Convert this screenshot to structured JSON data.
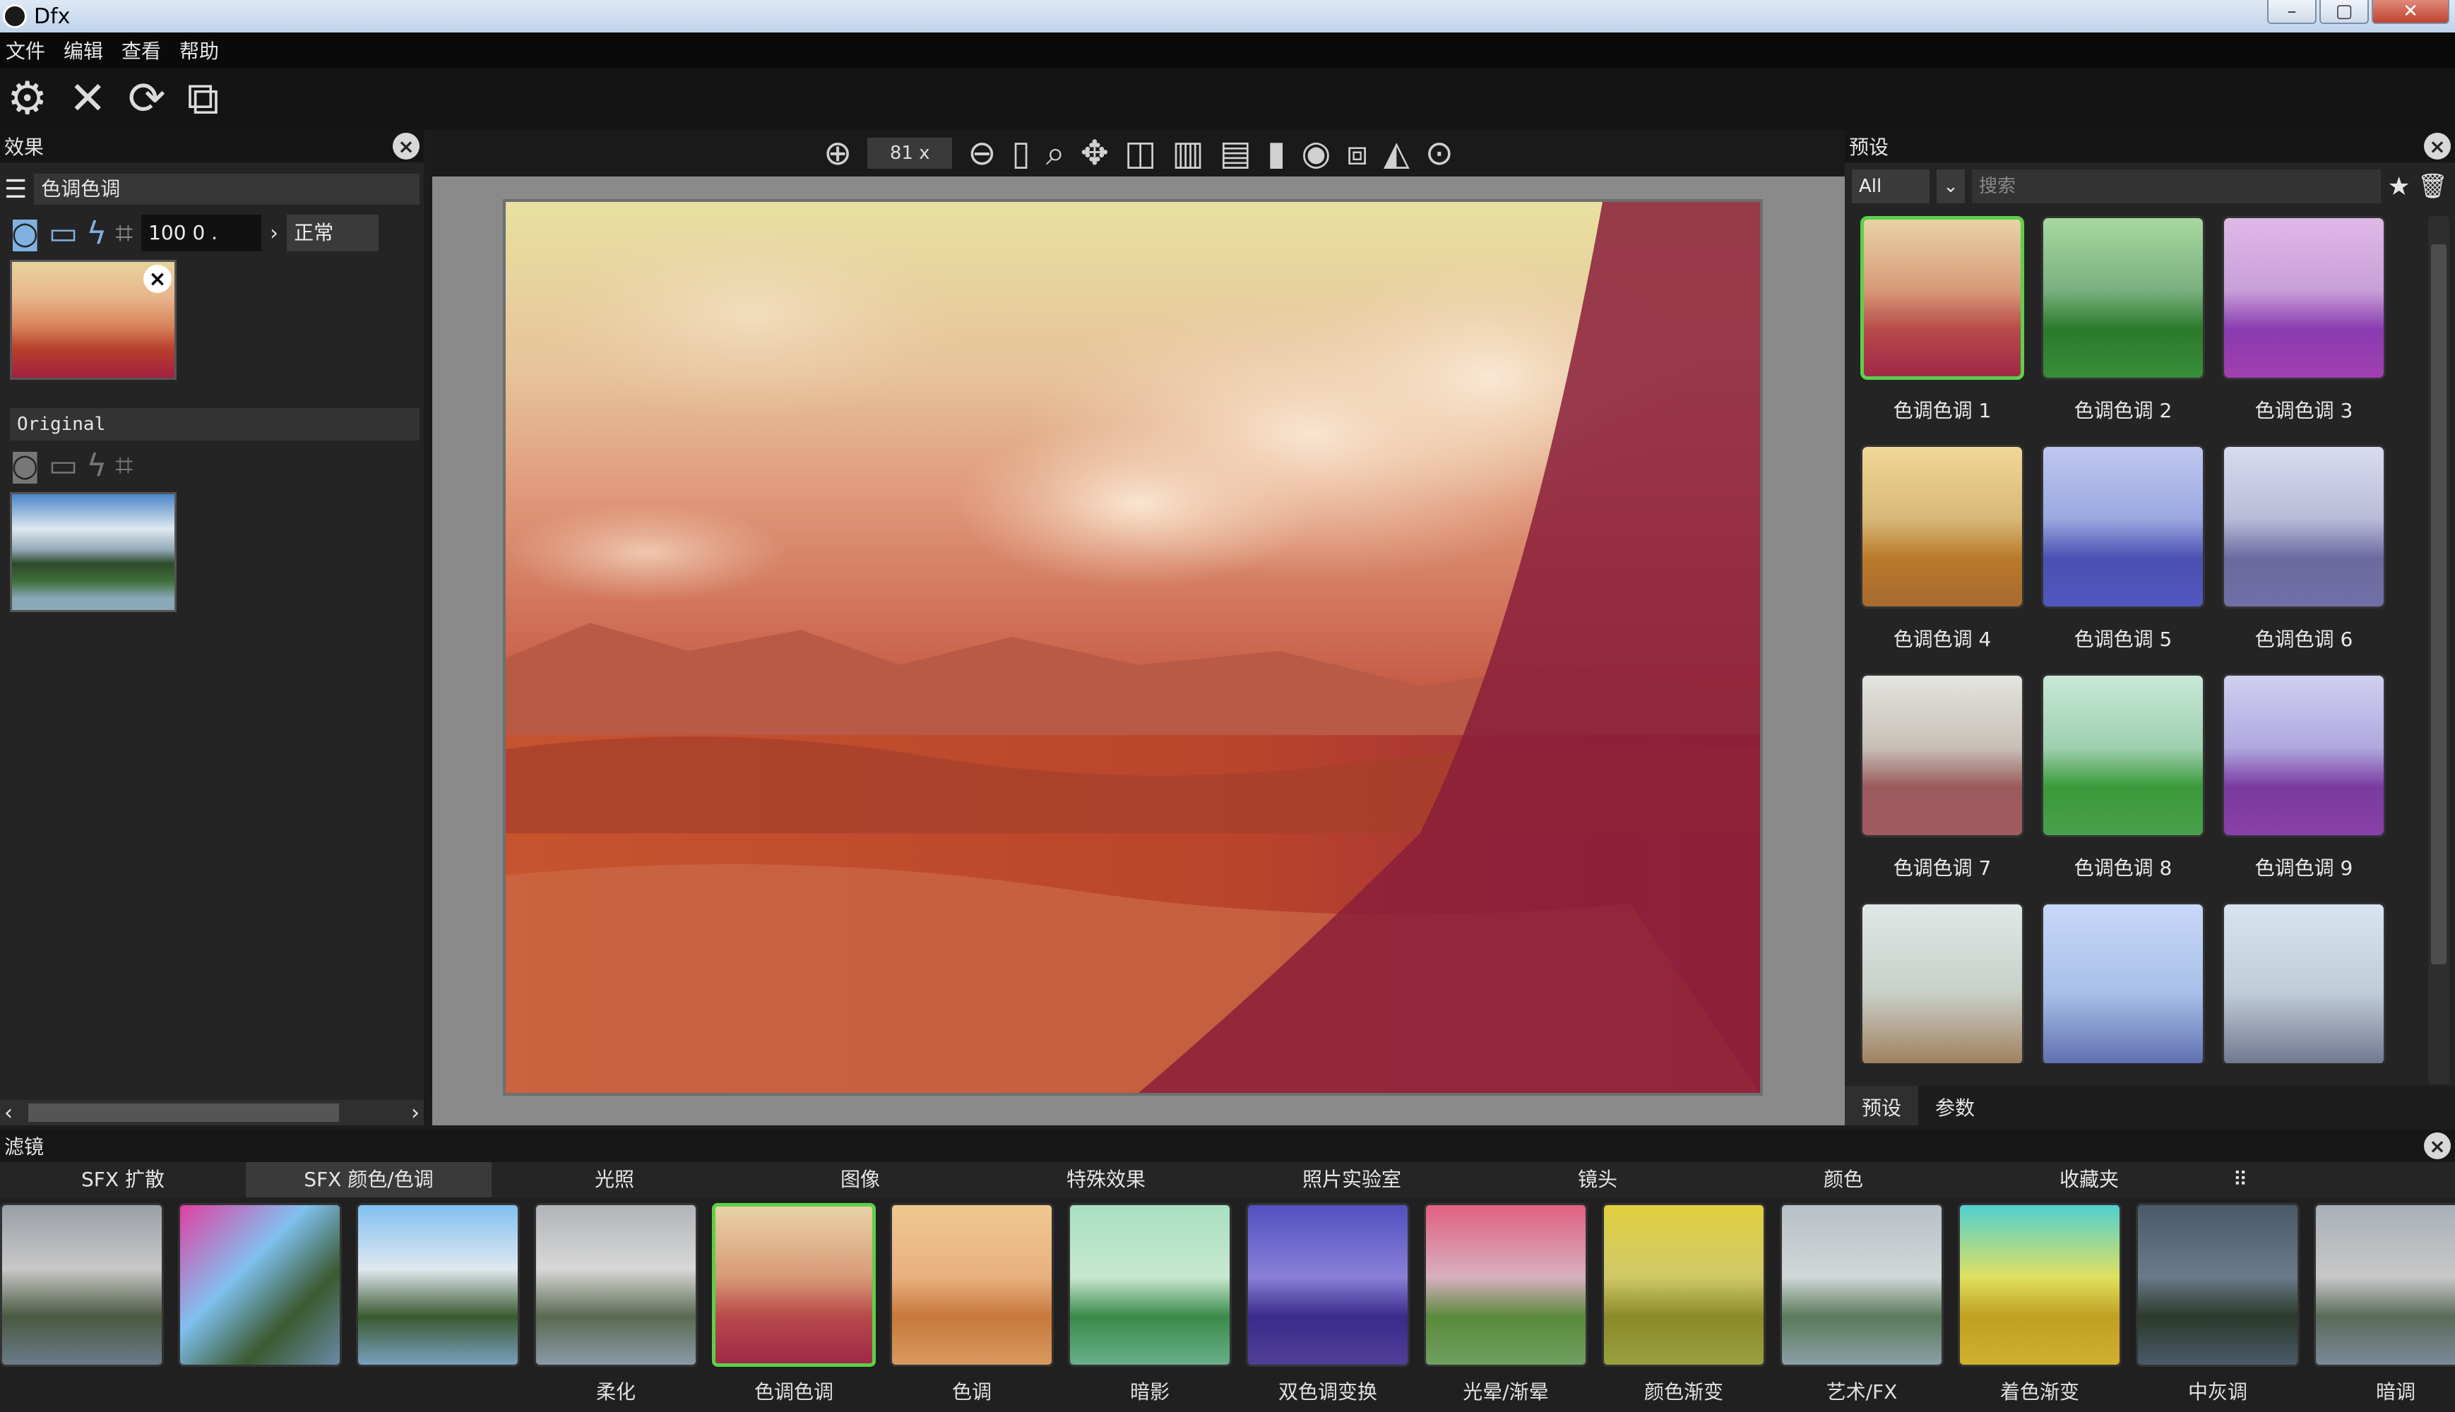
{
  "window": {
    "title": "Dfx",
    "buttons": [
      "–",
      "▢",
      "✕"
    ]
  },
  "menu": {
    "items": [
      "文件",
      "编辑",
      "查看",
      "帮助"
    ]
  },
  "toolbar": {
    "icons": [
      "gear-icon",
      "close-x-icon",
      "refresh-icon",
      "snapshot-frame-icon"
    ]
  },
  "effects_panel": {
    "title": "效果",
    "effect_name": "色调色调",
    "amount_value": "100 0 .",
    "blend_mode": "正常",
    "original_label": "Original"
  },
  "viewer": {
    "zoom_value": "81 x"
  },
  "presets_panel": {
    "title": "预设",
    "filter_value": "All",
    "search_placeholder": "搜索",
    "presets": [
      {
        "label": "色调色调 1"
      },
      {
        "label": "色调色调 2"
      },
      {
        "label": "色调色调 3"
      },
      {
        "label": "色调色调 4"
      },
      {
        "label": "色调色调 5"
      },
      {
        "label": "色调色调 6"
      },
      {
        "label": "色调色调 7"
      },
      {
        "label": "色调色调 8"
      },
      {
        "label": "色调色调 9"
      },
      {
        "label": ""
      },
      {
        "label": ""
      },
      {
        "label": ""
      }
    ],
    "tabs": [
      "预设",
      "参数"
    ]
  },
  "filters_panel": {
    "title": "滤镜",
    "categories": [
      "SFX 扩散",
      "SFX 颜色/色调",
      "光照",
      "图像",
      "特殊效果",
      "照片实验室",
      "镜头",
      "颜色",
      "收藏夹"
    ],
    "active_category": 1,
    "filters": [
      {
        "label": ""
      },
      {
        "label": ""
      },
      {
        "label": ""
      },
      {
        "label": "柔化"
      },
      {
        "label": "色调色调"
      },
      {
        "label": "色调"
      },
      {
        "label": "暗影"
      },
      {
        "label": "双色调变换"
      },
      {
        "label": "光晕/渐晕"
      },
      {
        "label": "颜色渐变"
      },
      {
        "label": "艺术/FX"
      },
      {
        "label": "着色渐变"
      },
      {
        "label": "中灰调"
      },
      {
        "label": "暗调"
      }
    ]
  },
  "colors": {
    "accent_selected": "#5cd04a",
    "background": "#1c1c1c"
  }
}
